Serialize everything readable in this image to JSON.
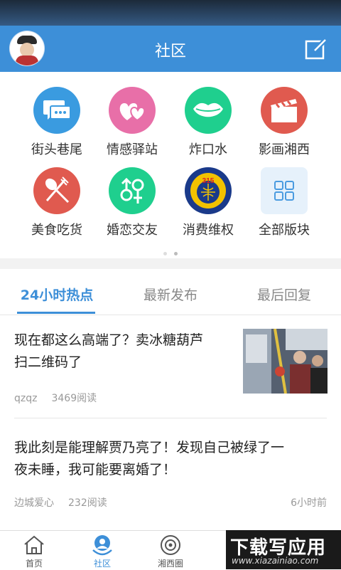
{
  "header": {
    "title": "社区"
  },
  "colors": {
    "brand": "#3d8fd8",
    "divider": "#e6e6e6"
  },
  "categories": [
    {
      "label": "街头巷尾",
      "icon": "chat-bubble-icon",
      "color": "#3a9be0"
    },
    {
      "label": "情感驿站",
      "icon": "hearts-icon",
      "color": "#e86fa8"
    },
    {
      "label": "炸口水",
      "icon": "lips-icon",
      "color": "#1fcf8e"
    },
    {
      "label": "影画湘西",
      "icon": "clapperboard-icon",
      "color": "#e05a4f"
    },
    {
      "label": "美食吃货",
      "icon": "spoon-fork-icon",
      "color": "#e05a4f"
    },
    {
      "label": "婚恋交友",
      "icon": "gender-icon",
      "color": "#1fcf8e"
    },
    {
      "label": "消费维权",
      "icon": "consumer-rights-315-icon",
      "color": "#1a3a8a"
    },
    {
      "label": "全部版块",
      "icon": "grid-icon",
      "color": "#e6f1fb"
    }
  ],
  "tabs": [
    {
      "label": "24小时热点",
      "active": true
    },
    {
      "label": "最新发布",
      "active": false
    },
    {
      "label": "最后回复",
      "active": false
    }
  ],
  "posts": [
    {
      "title_line1": "现在都这么高端了？卖冰糖葫芦",
      "title_line2": "扫二维码了",
      "author": "qzqz",
      "views": "3469阅读",
      "time": ""
    },
    {
      "title_line1": "我此刻是能理解贾乃亮了！发现自己被绿了一",
      "title_line2": "夜未睡，我可能要离婚了！",
      "author": "边城爱心",
      "views": "232阅读",
      "time": "6小时前"
    }
  ],
  "nav": [
    {
      "label": "首页",
      "icon": "home-icon"
    },
    {
      "label": "社区",
      "icon": "community-icon",
      "active": true
    },
    {
      "label": "湘西圈",
      "icon": "circle-eye-icon"
    }
  ],
  "watermark": {
    "text": "下载写应用",
    "sub": "www.xiazainiao.com"
  }
}
